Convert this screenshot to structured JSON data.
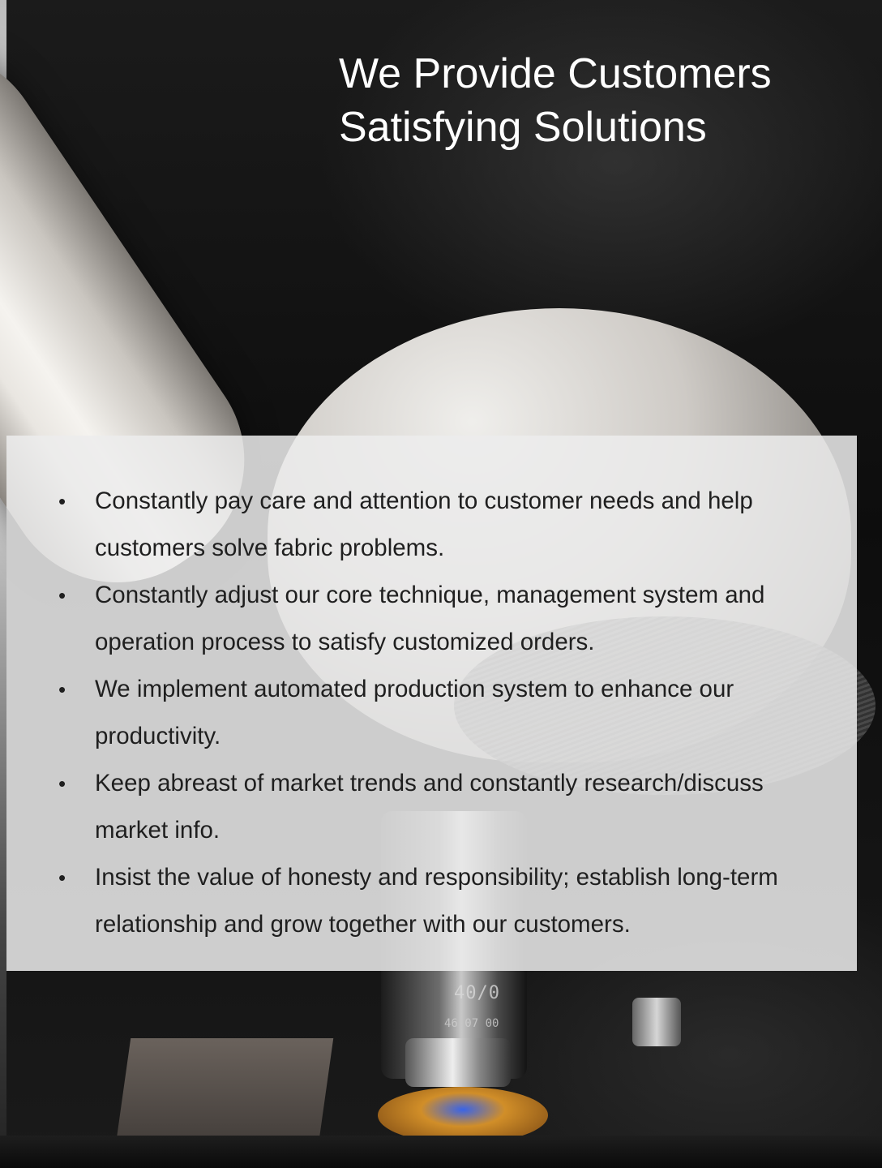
{
  "title": {
    "line1": "We Provide Customers",
    "line2": "Satisfying Solutions"
  },
  "bullets": [
    "Constantly pay care and attention to customer needs and help customers solve fabric problems.",
    "Constantly adjust our core technique, management system and operation process to satisfy customized orders.",
    "We implement automated production system to enhance our productivity.",
    "Keep abreast of market trends and constantly research/discuss market info.",
    "Insist the value of honesty and responsibility; establish long-term relationship and grow together with our customers."
  ],
  "background": {
    "lens_marking": "40/0",
    "lens_serial": "46 07 00",
    "colors": {
      "title_text": "#ffffff",
      "panel": "#ececec",
      "body_text": "#1f1f1f",
      "background": "#141414"
    }
  }
}
